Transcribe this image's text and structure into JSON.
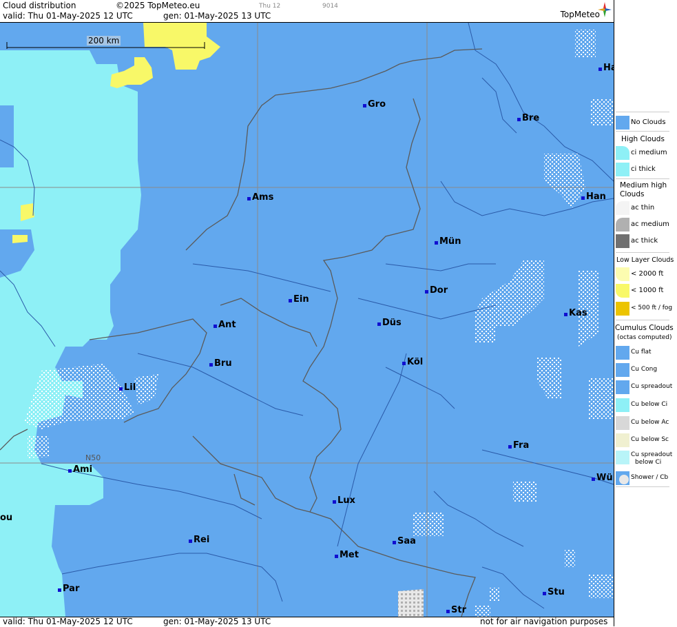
{
  "header": {
    "title": "Cloud distribution",
    "copyright": "©2025 TopMeteo.eu",
    "run_label": "Thu 12",
    "code": "9014",
    "valid": "valid:  Thu  01-May-2025  12 UTC",
    "gen": "gen: 01-May-2025 13 UTC",
    "brand": "TopMeteo"
  },
  "map": {
    "scale_label": "200 km",
    "lat_label": "N50",
    "cities": [
      {
        "name": "Gro"
      },
      {
        "name": "Bre"
      },
      {
        "name": "Ha"
      },
      {
        "name": "Ams"
      },
      {
        "name": "Han"
      },
      {
        "name": "Mün"
      },
      {
        "name": "Ein"
      },
      {
        "name": "Dor"
      },
      {
        "name": "Ant"
      },
      {
        "name": "Düs"
      },
      {
        "name": "Kas"
      },
      {
        "name": "Bru"
      },
      {
        "name": "Köl"
      },
      {
        "name": "Lil"
      },
      {
        "name": "Fra"
      },
      {
        "name": "Ami"
      },
      {
        "name": "Wü"
      },
      {
        "name": "Lux"
      },
      {
        "name": "ou"
      },
      {
        "name": "Rei"
      },
      {
        "name": "Saa"
      },
      {
        "name": "Met"
      },
      {
        "name": "Par"
      },
      {
        "name": "Stu"
      },
      {
        "name": "Str"
      }
    ]
  },
  "footer": {
    "valid": "valid:  Thu  01-May-2025  12 UTC",
    "gen": "gen: 01-May-2025 13 UTC",
    "disclaimer": "not for air navigation purposes"
  },
  "legend": {
    "no_clouds": "No Clouds",
    "high_head": "High Clouds",
    "ci_medium": "ci medium",
    "ci_thick": "ci thick",
    "mid_head1": "Medium high",
    "mid_head2": "Clouds",
    "ac_thin": "ac thin",
    "ac_medium": "ac medium",
    "ac_thick": "ac thick",
    "low_head": "Low Layer Clouds",
    "low_2000": "< 2000 ft",
    "low_1000": "< 1000 ft",
    "low_500": "< 500 ft / fog",
    "cu_head1": "Cumulus Clouds",
    "cu_head2": "(octas computed)",
    "cu_flat": "Cu flat",
    "cu_cong": "Cu Cong",
    "cu_spread": "Cu spreadout",
    "cu_below_ci": "Cu below Ci",
    "cu_below_ac": "Cu below Ac",
    "cu_below_sc": "Cu below Sc",
    "cu_spread_ci1": "Cu spreadout",
    "cu_spread_ci2": "below Ci",
    "shower": "Shower / Cb"
  },
  "colors": {
    "no_clouds": "#62a8ee",
    "ci": "#8ef0f6",
    "low_2000": "#fcfcb0",
    "low_1000": "#f8f868",
    "fog": "#ecc400",
    "ac_medium": "#b0b0b0",
    "ac_thick": "#707070"
  }
}
